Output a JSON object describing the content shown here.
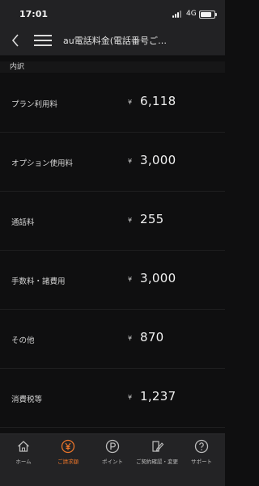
{
  "status_bar": {
    "time": "17:01",
    "network": "4G"
  },
  "nav": {
    "title": "au電話料金(電話番号ご…"
  },
  "section": {
    "title": "内訳"
  },
  "currency": "¥",
  "rows": [
    {
      "label": "プラン利用料",
      "amount": "6,118"
    },
    {
      "label": "オプション使用料",
      "amount": "3,000"
    },
    {
      "label": "通話料",
      "amount": "255"
    },
    {
      "label": "手数料・諸費用",
      "amount": "3,000"
    },
    {
      "label": "その他",
      "amount": "870"
    },
    {
      "label": "消費税等",
      "amount": "1,237"
    }
  ],
  "tabs": [
    {
      "label": "ホーム",
      "icon": "home-icon"
    },
    {
      "label": "ご請求額",
      "icon": "yen-icon",
      "active": true
    },
    {
      "label": "ポイント",
      "icon": "points-icon"
    },
    {
      "label": "ご契約確認・変更",
      "icon": "contract-edit-icon"
    },
    {
      "label": "サポート",
      "icon": "support-icon"
    }
  ],
  "colors": {
    "accent": "#e8742a",
    "background": "#0f0f10",
    "bar": "#222224"
  }
}
